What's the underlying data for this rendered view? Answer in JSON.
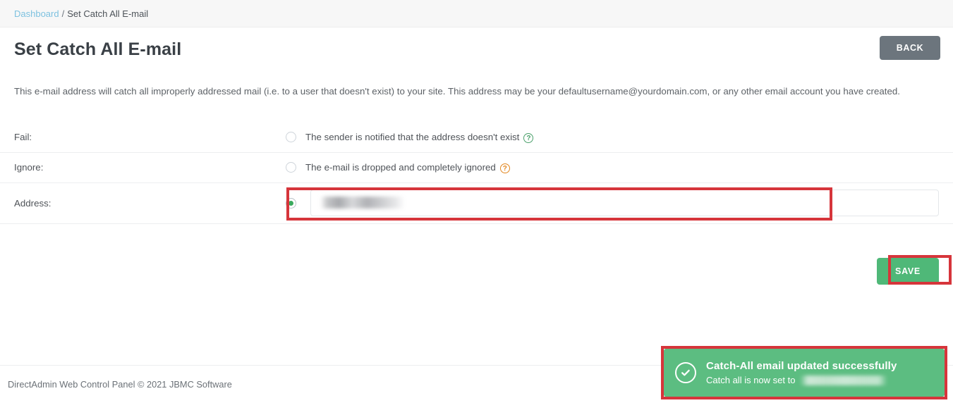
{
  "breadcrumb": {
    "link_label": "Dashboard",
    "separator": "/",
    "current_label": "Set Catch All E-mail"
  },
  "header": {
    "title": "Set Catch All E-mail",
    "back_label": "BACK"
  },
  "description": "This e-mail address will catch all improperly addressed mail (i.e. to a user that doesn't exist) to your site. This address may be your defaultusername@yourdomain.com, or any other email account you have created.",
  "form": {
    "rows": [
      {
        "label": "Fail:",
        "option_text": "The sender is notified that the address doesn't exist",
        "help_icon": "help-circle-icon",
        "help_color": "#4aa06a",
        "selected": false
      },
      {
        "label": "Ignore:",
        "option_text": "The e-mail is dropped and completely ignored",
        "help_icon": "help-circle-icon",
        "help_color": "#e2861f",
        "selected": false
      }
    ],
    "address_row": {
      "label": "Address:",
      "selected": true,
      "input_value": "",
      "input_placeholder": ""
    }
  },
  "actions": {
    "save_label": "SAVE"
  },
  "toast": {
    "icon": "check-circle-icon",
    "title": "Catch-All email updated successfully",
    "subtitle": "Catch all is now set to",
    "background": "#5cbd81"
  },
  "footer": {
    "text": "DirectAdmin Web Control Panel © 2021 JBMC Software"
  },
  "colors": {
    "accent_green": "#4fb878",
    "breadcrumb_link": "#7ec2e0",
    "back_button": "#6c757d",
    "annotation_red": "#d6353b"
  }
}
